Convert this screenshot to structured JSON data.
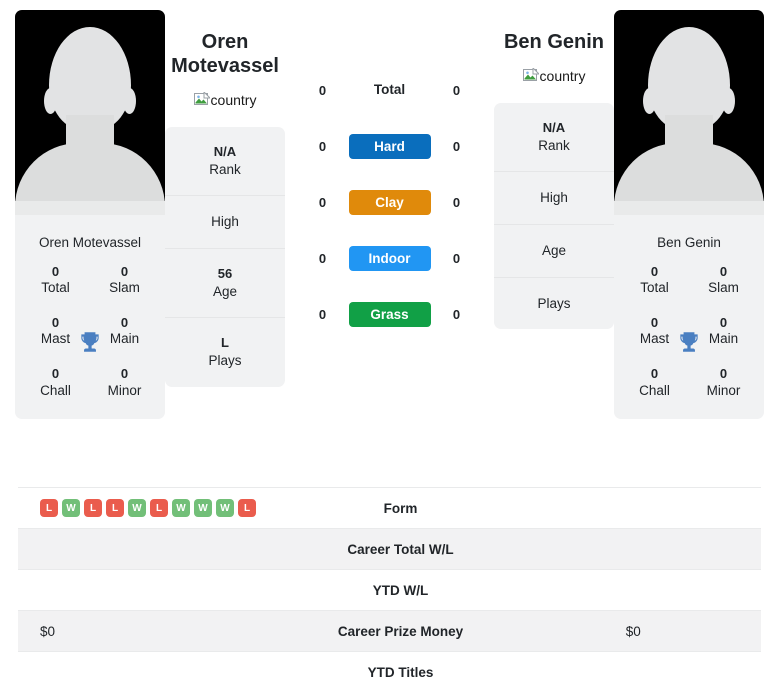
{
  "players": [
    {
      "heading": "Oren Motevassel",
      "photo_name": "Oren Motevassel",
      "flag_alt": "country",
      "titles": [
        {
          "num": "0",
          "label": "Total"
        },
        {
          "num": "0",
          "label": "Slam"
        },
        {
          "num": "0",
          "label": "Mast"
        },
        {
          "num": "0",
          "label": "Main"
        },
        {
          "num": "0",
          "label": "Chall"
        },
        {
          "num": "0",
          "label": "Minor"
        }
      ],
      "info": [
        {
          "value": "N/A",
          "label": "Rank"
        },
        {
          "value": "",
          "label": "High"
        },
        {
          "value": "56",
          "label": "Age"
        },
        {
          "value": "L",
          "label": "Plays"
        }
      ]
    },
    {
      "heading": "Ben Genin",
      "photo_name": "Ben Genin",
      "flag_alt": "country",
      "titles": [
        {
          "num": "0",
          "label": "Total"
        },
        {
          "num": "0",
          "label": "Slam"
        },
        {
          "num": "0",
          "label": "Mast"
        },
        {
          "num": "0",
          "label": "Main"
        },
        {
          "num": "0",
          "label": "Chall"
        },
        {
          "num": "0",
          "label": "Minor"
        }
      ],
      "info": [
        {
          "value": "N/A",
          "label": "Rank"
        },
        {
          "value": "",
          "label": "High"
        },
        {
          "value": "",
          "label": "Age"
        },
        {
          "value": "",
          "label": "Plays"
        }
      ]
    }
  ],
  "surfaces": [
    {
      "label": "Total",
      "left": "0",
      "right": "0",
      "badge": false,
      "color": ""
    },
    {
      "label": "Hard",
      "left": "0",
      "right": "0",
      "badge": true,
      "color": "#0a6ebd"
    },
    {
      "label": "Clay",
      "left": "0",
      "right": "0",
      "badge": true,
      "color": "#e08a0b"
    },
    {
      "label": "Indoor",
      "left": "0",
      "right": "0",
      "badge": true,
      "color": "#2196f3"
    },
    {
      "label": "Grass",
      "left": "0",
      "right": "0",
      "badge": true,
      "color": "#11a046"
    }
  ],
  "form": {
    "left_results": [
      "L",
      "W",
      "L",
      "L",
      "W",
      "L",
      "W",
      "W",
      "W",
      "L"
    ],
    "right_results": [],
    "win_color": "#72bf78",
    "loss_color": "#ea5c4d"
  },
  "stats_rows": [
    {
      "label": "Form",
      "left": "",
      "right": "",
      "shaded": false,
      "is_form": true
    },
    {
      "label": "Career Total W/L",
      "left": "",
      "right": "",
      "shaded": true,
      "is_form": false
    },
    {
      "label": "YTD W/L",
      "left": "",
      "right": "",
      "shaded": false,
      "is_form": false
    },
    {
      "label": "Career Prize Money",
      "left": "$0",
      "right": "$0",
      "shaded": true,
      "is_form": false
    },
    {
      "label": "YTD Titles",
      "left": "",
      "right": "",
      "shaded": false,
      "is_form": false
    }
  ],
  "colors": {
    "trophy": "#4a7fc1",
    "card_bg": "#f1f2f3",
    "row_shade": "#f2f2f3"
  }
}
